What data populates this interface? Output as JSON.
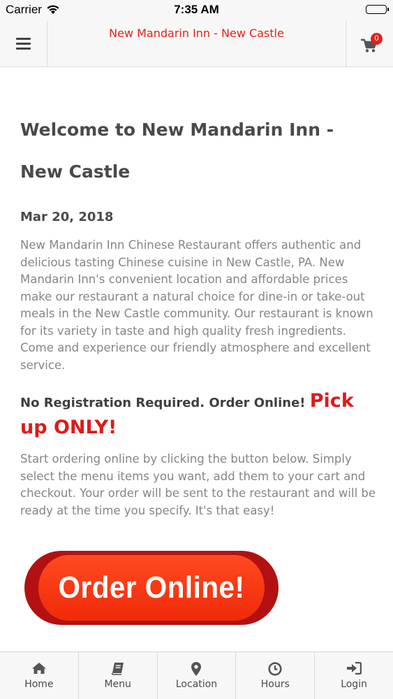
{
  "status_bar": {
    "carrier": "Carrier",
    "time": "7:35 AM"
  },
  "header": {
    "title": "New Mandarin Inn - New Castle",
    "cart_count": "0",
    "menu_icon": "hamburger-menu-icon",
    "cart_icon": "shopping-cart-icon"
  },
  "main": {
    "title": "Welcome to New Mandarin Inn - New Castle",
    "date": "Mar 20, 2018",
    "intro": "New Mandarin Inn Chinese Restaurant offers authentic and delicious tasting Chinese cuisine in New Castle, PA.  New Mandarin Inn's convenient location and affordable prices make our restaurant a natural choice for dine-in or take-out meals in the New Castle community. Our restaurant is known for its variety in taste and high quality fresh ingredients. Come and experience our friendly atmosphere and excellent service.",
    "notice_text": "No Registration Required. Order Online! ",
    "notice_emphasis": "Pick up ONLY!",
    "instructions": "Start ordering online by clicking the button below. Simply select the menu items you want, add them to your cart and checkout. Your order will be sent to the restaurant and will be ready at the time you specify. It's that easy!",
    "order_button_label": "Order Online!"
  },
  "tabs": [
    {
      "label": "Home",
      "icon": "home-icon"
    },
    {
      "label": "Menu",
      "icon": "book-icon"
    },
    {
      "label": "Location",
      "icon": "map-pin-icon"
    },
    {
      "label": "Hours",
      "icon": "clock-icon"
    },
    {
      "label": "Login",
      "icon": "sign-in-icon"
    }
  ],
  "colors": {
    "accent_red": "#e0231b",
    "order_button": "#f02a0a",
    "text_dark": "#4a4a4a",
    "text_body": "#858585"
  }
}
